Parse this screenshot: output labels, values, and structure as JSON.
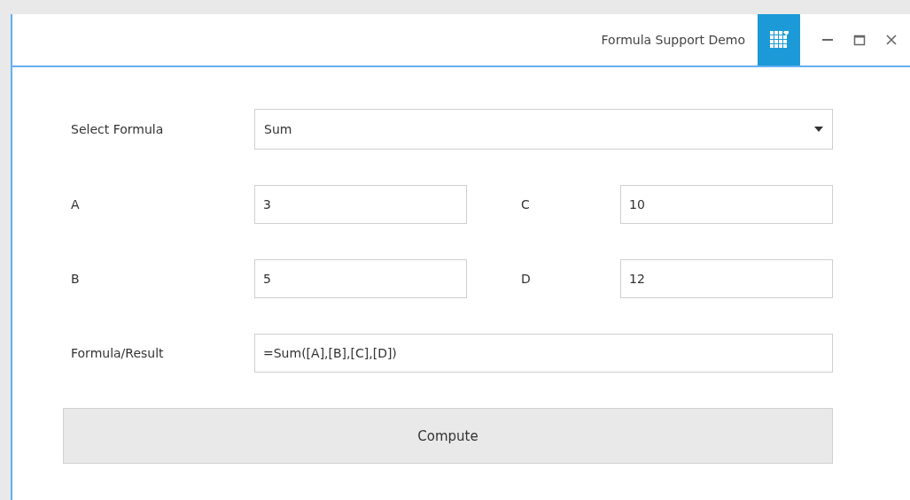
{
  "window": {
    "title": "Formula Support Demo"
  },
  "formula_select": {
    "label": "Select Formula",
    "value": "Sum"
  },
  "fields": [
    {
      "label": "A",
      "value": "3"
    },
    {
      "label": "C",
      "value": "10"
    },
    {
      "label": "B",
      "value": "5"
    },
    {
      "label": "D",
      "value": "12"
    }
  ],
  "result": {
    "label": "Formula/Result",
    "value": "=Sum([A],[B],[C],[D])"
  },
  "buttons": [
    "Compute"
  ]
}
